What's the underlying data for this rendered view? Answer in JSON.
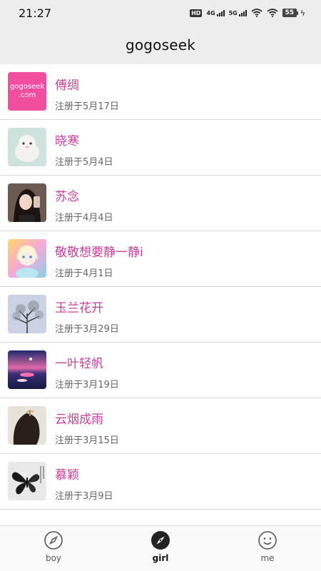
{
  "status_bar": {
    "time": "21:27",
    "hd_label": "HD",
    "network_1": "4G",
    "network_2": "5G",
    "battery": "55"
  },
  "app": {
    "title": "gogoseek"
  },
  "users": [
    {
      "name": "傅绸",
      "registered": "注册于5月17日",
      "avatar": "gogoseek-logo",
      "logo_line1": "gogoseek",
      "logo_line2": ".com"
    },
    {
      "name": "晓寒",
      "registered": "注册于5月4日",
      "avatar": "plush-toy"
    },
    {
      "name": "苏念",
      "registered": "注册于4月4日",
      "avatar": "girl-selfie"
    },
    {
      "name": "敬敬想要静一静i",
      "registered": "注册于4月1日",
      "avatar": "anime-girl"
    },
    {
      "name": "玉兰花开",
      "registered": "注册于3月29日",
      "avatar": "tree-sky"
    },
    {
      "name": "一叶轻帆",
      "registered": "注册于3月19日",
      "avatar": "sunset-water"
    },
    {
      "name": "云烟成雨",
      "registered": "注册于3月15日",
      "avatar": "woman-back"
    },
    {
      "name": "慕颖",
      "registered": "注册于3月9日",
      "avatar": "butterfly"
    }
  ],
  "tabs": [
    {
      "label": "boy",
      "icon": "compass-outline-icon",
      "active": false
    },
    {
      "label": "girl",
      "icon": "compass-filled-icon",
      "active": true
    },
    {
      "label": "me",
      "icon": "smiley-icon",
      "active": false
    }
  ],
  "colors": {
    "accent": "#c9409a",
    "header_bg": "#ededed",
    "logo_bg": "#f04fa0"
  }
}
